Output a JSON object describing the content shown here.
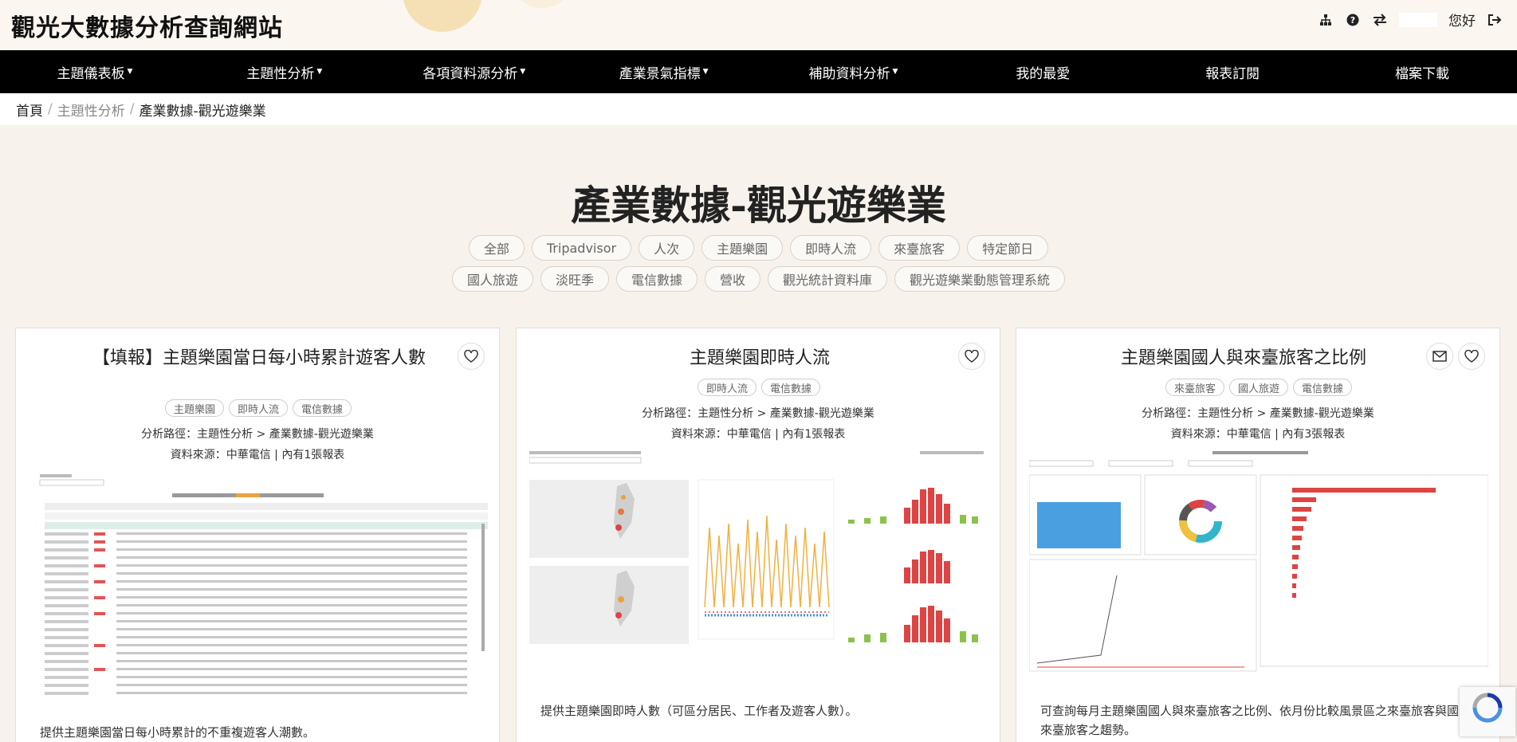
{
  "site": {
    "title": "觀光大數據分析查詢網站",
    "greeting": "您好"
  },
  "header_icons": [
    "sitemap-icon",
    "help-icon",
    "swap-icon",
    "logout-icon"
  ],
  "nav": [
    {
      "label": "主題儀表板",
      "dropdown": true
    },
    {
      "label": "主題性分析",
      "dropdown": true
    },
    {
      "label": "各項資料源分析",
      "dropdown": true
    },
    {
      "label": "產業景氣指標",
      "dropdown": true
    },
    {
      "label": "補助資料分析",
      "dropdown": true
    },
    {
      "label": "我的最愛",
      "dropdown": false
    },
    {
      "label": "報表訂閱",
      "dropdown": false
    },
    {
      "label": "檔案下載",
      "dropdown": false
    }
  ],
  "breadcrumb": [
    "首頁",
    "主題性分析",
    "產業數據-觀光遊樂業"
  ],
  "page_title": "產業數據-觀光遊樂業",
  "filter_tags_row1": [
    "全部",
    "Tripadvisor",
    "人次",
    "主題樂園",
    "即時人流",
    "來臺旅客",
    "特定節日"
  ],
  "filter_tags_row2": [
    "國人旅遊",
    "淡旺季",
    "電信數據",
    "營收",
    "觀光統計資料庫",
    "觀光遊樂業動態管理系統"
  ],
  "cards": [
    {
      "title": "【填報】主題樂園當日每小時累計遊客人數",
      "tags": [
        "主題樂園",
        "即時人流",
        "電信數據"
      ],
      "path": "分析路徑：主題性分析 > 產業數據-觀光遊樂業",
      "source": "資料來源：中華電信 | 內有1張報表",
      "desc": "提供主題樂園當日每小時累計的不重複遊客人潮數。"
    },
    {
      "title": "主題樂園即時人流",
      "tags": [
        "即時人流",
        "電信數據"
      ],
      "path": "分析路徑：主題性分析 > 產業數據-觀光遊樂業",
      "source": "資料來源：中華電信 | 內有1張報表",
      "desc": "提供主題樂園即時人數（可區分居民、工作者及遊客人數）。"
    },
    {
      "title": "主題樂園國人與來臺旅客之比例",
      "tags": [
        "來臺旅客",
        "國人旅遊",
        "電信數據"
      ],
      "path": "分析路徑：主題性分析 > 產業數據-觀光遊樂業",
      "source": "資料來源：中華電信 | 內有3張報表",
      "desc": "可查詢每月主題樂園國人與來臺旅客之比例、依月份比較風景區之來臺旅客與國人與來臺旅客之趨勢。"
    }
  ]
}
